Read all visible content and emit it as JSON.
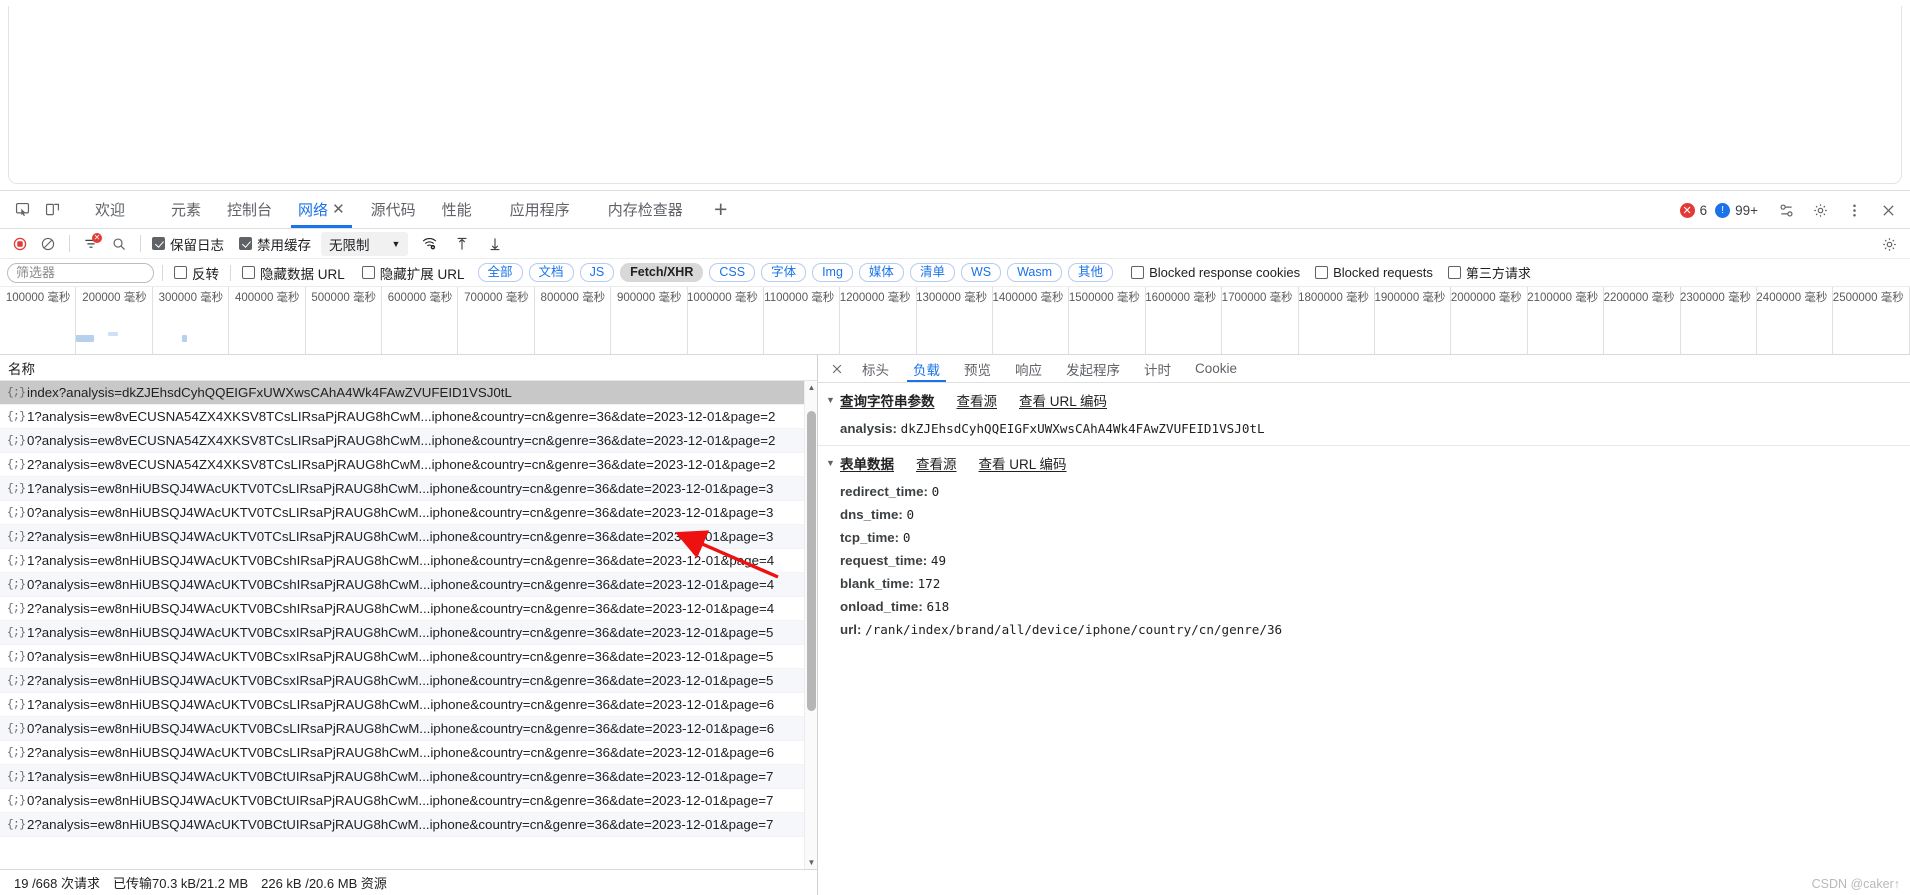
{
  "devtools": {
    "tabs": [
      {
        "label": "欢迎",
        "active": false,
        "closable": false
      },
      {
        "label": "元素",
        "active": false,
        "closable": false
      },
      {
        "label": "控制台",
        "active": false,
        "closable": false
      },
      {
        "label": "网络",
        "active": true,
        "closable": true
      },
      {
        "label": "源代码",
        "active": false,
        "closable": false
      },
      {
        "label": "性能",
        "active": false,
        "closable": false
      },
      {
        "label": "应用程序",
        "active": false,
        "closable": false
      },
      {
        "label": "内存检查器",
        "active": false,
        "closable": false
      }
    ],
    "add_tab_label": "+",
    "inspect_icon": "inspect-element-icon",
    "device_toolbar_icon": "device-toolbar-icon",
    "error_count": "6",
    "warning_count": "99+",
    "settings_icon": "gear-icon",
    "more_icon": "more-vertical-icon",
    "close_icon": "close-icon",
    "customize_icon": "customize-devtools-icon"
  },
  "net_toolbar": {
    "record_icon": "record-stop-icon",
    "clear_icon": "clear-icon",
    "filter_icon": "filter-icon",
    "search_icon": "search-icon",
    "preserve_log_label": "保留日志",
    "preserve_log_checked": true,
    "disable_cache_label": "禁用缓存",
    "disable_cache_checked": true,
    "throttle_value": "无限制",
    "network_conditions_icon": "wifi-settings-icon",
    "import_har_icon": "upload-arrow-icon",
    "export_har_icon": "download-arrow-icon",
    "network_settings_icon": "gear-icon"
  },
  "filter_bar": {
    "filter_placeholder": "筛选器",
    "filter_value": "",
    "invert_label": "反转",
    "invert_checked": false,
    "hide_data_urls_label": "隐藏数据 URL",
    "hide_data_urls_checked": false,
    "hide_ext_urls_label": "隐藏扩展 URL",
    "hide_ext_urls_checked": false,
    "types": [
      {
        "label": "全部",
        "selected": false
      },
      {
        "label": "文档",
        "selected": false
      },
      {
        "label": "JS",
        "selected": false
      },
      {
        "label": "Fetch/XHR",
        "selected": true
      },
      {
        "label": "CSS",
        "selected": false
      },
      {
        "label": "字体",
        "selected": false
      },
      {
        "label": "Img",
        "selected": false
      },
      {
        "label": "媒体",
        "selected": false
      },
      {
        "label": "清单",
        "selected": false
      },
      {
        "label": "WS",
        "selected": false
      },
      {
        "label": "Wasm",
        "selected": false
      },
      {
        "label": "其他",
        "selected": false
      }
    ],
    "blocked_response_cookies_label": "Blocked response cookies",
    "blocked_response_cookies_checked": false,
    "blocked_requests_label": "Blocked requests",
    "blocked_requests_checked": false,
    "third_party_label": "第三方请求",
    "third_party_checked": false
  },
  "overview": {
    "ticks": [
      "100000 毫秒",
      "200000 毫秒",
      "300000 毫秒",
      "400000 毫秒",
      "500000 毫秒",
      "600000 毫秒",
      "700000 毫秒",
      "800000 毫秒",
      "900000 毫秒",
      "1000000 毫秒",
      "1100000 毫秒",
      "1200000 毫秒",
      "1300000 毫秒",
      "1400000 毫秒",
      "1500000 毫秒",
      "1600000 毫秒",
      "1700000 毫秒",
      "1800000 毫秒",
      "1900000 毫秒",
      "2000000 毫秒",
      "2100000 毫秒",
      "2200000 毫秒",
      "2300000 毫秒",
      "2400000 毫秒",
      "2500000 毫秒"
    ]
  },
  "request_list": {
    "column_header": "名称",
    "rows": [
      {
        "name": "index?analysis=dkZJEhsdCyhQQEIGFxUWXwsCAhA4Wk4FAwZVUFEID1VSJ0tL",
        "selected": true
      },
      {
        "name": "1?analysis=ew8vECUSNA54ZX4XKSV8TCsLIRsaPjRAUG8hCwM...iphone&country=cn&genre=36&date=2023-12-01&page=2",
        "selected": false
      },
      {
        "name": "0?analysis=ew8vECUSNA54ZX4XKSV8TCsLIRsaPjRAUG8hCwM...iphone&country=cn&genre=36&date=2023-12-01&page=2",
        "selected": false
      },
      {
        "name": "2?analysis=ew8vECUSNA54ZX4XKSV8TCsLIRsaPjRAUG8hCwM...iphone&country=cn&genre=36&date=2023-12-01&page=2",
        "selected": false
      },
      {
        "name": "1?analysis=ew8nHiUBSQJ4WAcUKTV0TCsLIRsaPjRAUG8hCwM...iphone&country=cn&genre=36&date=2023-12-01&page=3",
        "selected": false
      },
      {
        "name": "0?analysis=ew8nHiUBSQJ4WAcUKTV0TCsLIRsaPjRAUG8hCwM...iphone&country=cn&genre=36&date=2023-12-01&page=3",
        "selected": false
      },
      {
        "name": "2?analysis=ew8nHiUBSQJ4WAcUKTV0TCsLIRsaPjRAUG8hCwM...iphone&country=cn&genre=36&date=2023-12-01&page=3",
        "selected": false
      },
      {
        "name": "1?analysis=ew8nHiUBSQJ4WAcUKTV0BCshIRsaPjRAUG8hCwM...iphone&country=cn&genre=36&date=2023-12-01&page=4",
        "selected": false
      },
      {
        "name": "0?analysis=ew8nHiUBSQJ4WAcUKTV0BCshIRsaPjRAUG8hCwM...iphone&country=cn&genre=36&date=2023-12-01&page=4",
        "selected": false
      },
      {
        "name": "2?analysis=ew8nHiUBSQJ4WAcUKTV0BCshIRsaPjRAUG8hCwM...iphone&country=cn&genre=36&date=2023-12-01&page=4",
        "selected": false
      },
      {
        "name": "1?analysis=ew8nHiUBSQJ4WAcUKTV0BCsxIRsaPjRAUG8hCwM...iphone&country=cn&genre=36&date=2023-12-01&page=5",
        "selected": false
      },
      {
        "name": "0?analysis=ew8nHiUBSQJ4WAcUKTV0BCsxIRsaPjRAUG8hCwM...iphone&country=cn&genre=36&date=2023-12-01&page=5",
        "selected": false
      },
      {
        "name": "2?analysis=ew8nHiUBSQJ4WAcUKTV0BCsxIRsaPjRAUG8hCwM...iphone&country=cn&genre=36&date=2023-12-01&page=5",
        "selected": false
      },
      {
        "name": "1?analysis=ew8nHiUBSQJ4WAcUKTV0BCsLIRsaPjRAUG8hCwM...iphone&country=cn&genre=36&date=2023-12-01&page=6",
        "selected": false
      },
      {
        "name": "0?analysis=ew8nHiUBSQJ4WAcUKTV0BCsLIRsaPjRAUG8hCwM...iphone&country=cn&genre=36&date=2023-12-01&page=6",
        "selected": false
      },
      {
        "name": "2?analysis=ew8nHiUBSQJ4WAcUKTV0BCsLIRsaPjRAUG8hCwM...iphone&country=cn&genre=36&date=2023-12-01&page=6",
        "selected": false
      },
      {
        "name": "1?analysis=ew8nHiUBSQJ4WAcUKTV0BCtUIRsaPjRAUG8hCwM...iphone&country=cn&genre=36&date=2023-12-01&page=7",
        "selected": false
      },
      {
        "name": "0?analysis=ew8nHiUBSQJ4WAcUKTV0BCtUIRsaPjRAUG8hCwM...iphone&country=cn&genre=36&date=2023-12-01&page=7",
        "selected": false
      },
      {
        "name": "2?analysis=ew8nHiUBSQJ4WAcUKTV0BCtUIRsaPjRAUG8hCwM...iphone&country=cn&genre=36&date=2023-12-01&page=7",
        "selected": false
      }
    ]
  },
  "status_bar": {
    "requests": "19 /668 次请求",
    "transferred": "已传输70.3 kB/21.2 MB",
    "resources": "226 kB /20.6 MB 资源"
  },
  "detail_panel": {
    "close_icon": "close-icon",
    "tabs": [
      {
        "label": "标头",
        "active": false
      },
      {
        "label": "负载",
        "active": true
      },
      {
        "label": "预览",
        "active": false
      },
      {
        "label": "响应",
        "active": false
      },
      {
        "label": "发起程序",
        "active": false
      },
      {
        "label": "计时",
        "active": false
      },
      {
        "label": "Cookie",
        "active": false
      }
    ],
    "query_section": {
      "title": "查询字符串参数",
      "view_source": "查看源",
      "view_url_encoded": "查看 URL 编码",
      "params": [
        {
          "key": "analysis:",
          "value": "dkZJEhsdCyhQQEIGFxUWXwsCAhA4Wk4FAwZVUFEID1VSJ0tL"
        }
      ]
    },
    "form_section": {
      "title": "表单数据",
      "view_source": "查看源",
      "view_url_encoded": "查看 URL 编码",
      "params": [
        {
          "key": "redirect_time:",
          "value": "0"
        },
        {
          "key": "dns_time:",
          "value": "0"
        },
        {
          "key": "tcp_time:",
          "value": "0"
        },
        {
          "key": "request_time:",
          "value": "49"
        },
        {
          "key": "blank_time:",
          "value": "172"
        },
        {
          "key": "onload_time:",
          "value": "618"
        },
        {
          "key": "url:",
          "value": "/rank/index/brand/all/device/iphone/country/cn/genre/36"
        }
      ]
    }
  },
  "watermark": "CSDN @caker↑",
  "colors": {
    "accent": "#1a73e8",
    "error": "#e53935",
    "selected_row": "#c8c8c8",
    "overview_bar": "#b8d0f0"
  }
}
